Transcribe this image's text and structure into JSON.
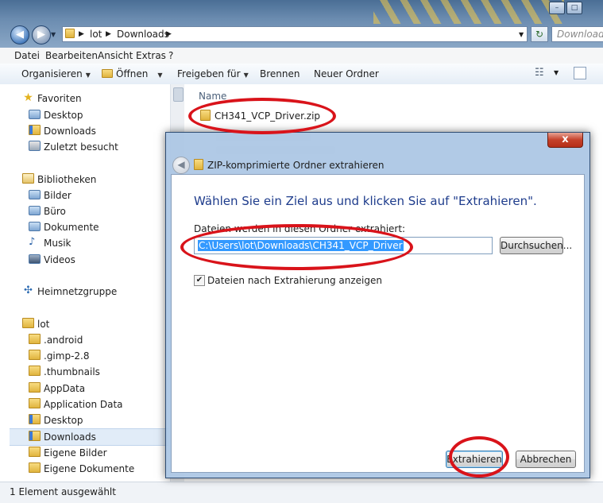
{
  "window": {
    "minimize_glyph": "–",
    "maximize_glyph": "□"
  },
  "address_bar": {
    "crumbs": [
      "lot",
      "Downloads"
    ],
    "search_placeholder": "Downloads d"
  },
  "menu": [
    "Datei",
    "Bearbeiten",
    "Ansicht",
    "Extras",
    "?"
  ],
  "toolbar": {
    "organize": "Organisieren",
    "open": "Öffnen",
    "share": "Freigeben für",
    "burn": "Brennen",
    "new_folder": "Neuer Ordner"
  },
  "nav_pane": {
    "favorites_header": "Favoriten",
    "favorites": [
      "Desktop",
      "Downloads",
      "Zuletzt besucht"
    ],
    "libraries_header": "Bibliotheken",
    "libraries": [
      "Bilder",
      "Büro",
      "Dokumente",
      "Musik",
      "Videos"
    ],
    "homegroup": "Heimnetzgruppe",
    "user_header": "lot",
    "user_folders": [
      ".android",
      ".gimp-2.8",
      ".thumbnails",
      "AppData",
      "Application Data",
      "Desktop",
      "Downloads",
      "Eigene Bilder",
      "Eigene Dokumente"
    ],
    "selected_folder": "Downloads"
  },
  "content": {
    "column_header": "Name",
    "file_name": "CH341_VCP_Driver.zip"
  },
  "status_bar": {
    "text": "1 Element ausgewählt"
  },
  "dialog": {
    "title": "ZIP-komprimierte Ordner extrahieren",
    "close_glyph": "x",
    "heading": "Wählen Sie ein Ziel aus und klicken Sie auf \"Extrahieren\".",
    "destination_label": "Dateien werden in diesen Ordner extrahiert:",
    "destination_value": "C:\\Users\\lot\\Downloads\\CH341_VCP_Driver",
    "browse_button": "Durchsuchen...",
    "show_files_checkbox": {
      "label": "Dateien nach Extrahierung anzeigen",
      "checked": true
    },
    "extract_button": "Extrahieren",
    "cancel_button": "Abbrechen"
  },
  "annotation_color": "#d9131a"
}
